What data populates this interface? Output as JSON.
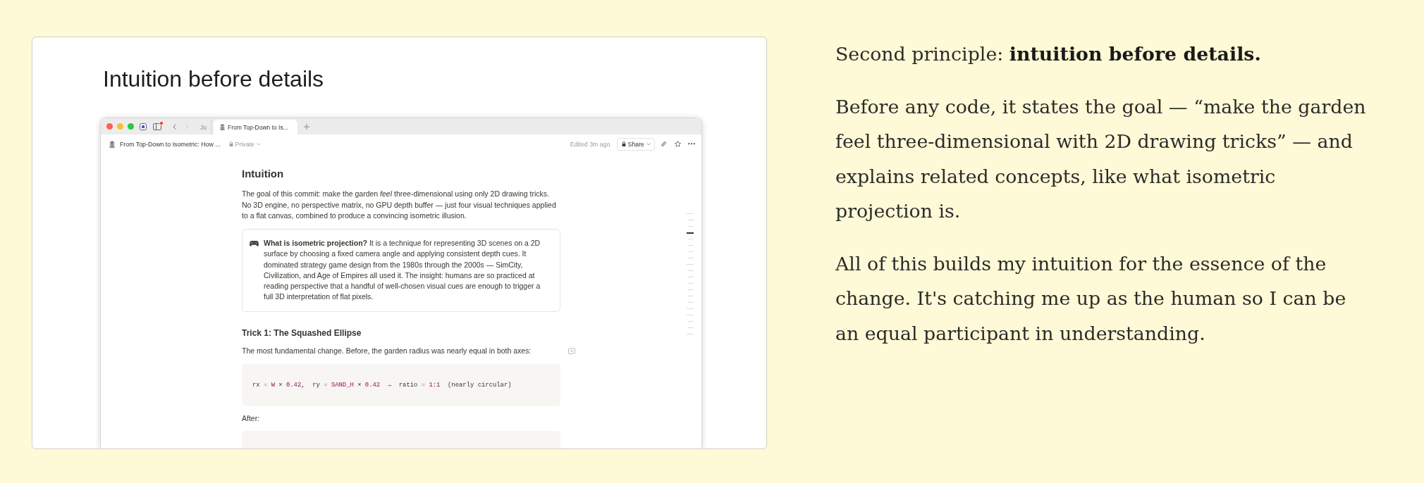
{
  "slide": {
    "title": "Intuition before details"
  },
  "browser": {
    "tabs": [
      {
        "label": "Ju",
        "kind": "compact",
        "selected": false
      },
      {
        "label": "From Top-Down to Is...",
        "kind": "page",
        "selected": true
      }
    ],
    "navigation": {
      "back_disabled": false,
      "forward_disabled": true
    },
    "page_title": "From Top-Down to Isometric: How ...",
    "privacy": "Private",
    "edited": "Edited 3m ago",
    "share": "Share"
  },
  "document": {
    "heading": "Intuition",
    "intro": "The goal of this commit: make the garden *feel* three-dimensional using only 2D drawing tricks. No 3D engine, no perspective matrix, no GPU depth buffer — just four visual techniques applied to a flat canvas, combined to produce a convincing isometric illusion.",
    "callout": "**What is isometric projection?** It is a technique for representing 3D scenes on a 2D surface by choosing a fixed camera angle and applying consistent depth cues. It dominated strategy game design from the 1980s through the 2000s — SimCity, Civilization, and Age of Empires all used it. The insight: humans are so practiced at reading perspective that a handful of well-chosen visual cues are enough to trigger a full 3D interpretation of flat pixels.",
    "section_heading": "Trick 1: The Squashed Ellipse",
    "paragraph": "The most fundamental change. Before, the garden radius was nearly equal in both axes:",
    "code": [
      {
        "text": "rx ",
        "kind": "plain"
      },
      {
        "text": "= ",
        "kind": "op"
      },
      {
        "text": "W",
        "kind": "value"
      },
      {
        "text": " × ",
        "kind": "plain"
      },
      {
        "text": "0.42",
        "kind": "value"
      },
      {
        "text": ",  ry ",
        "kind": "plain"
      },
      {
        "text": "= ",
        "kind": "op"
      },
      {
        "text": "SAND_H",
        "kind": "value"
      },
      {
        "text": " × ",
        "kind": "plain"
      },
      {
        "text": "0.42",
        "kind": "value"
      },
      {
        "text": "  →  ratio ",
        "kind": "plain"
      },
      {
        "text": "= ",
        "kind": "op"
      },
      {
        "text": "1:1",
        "kind": "value"
      },
      {
        "text": "  (nearly circular)",
        "kind": "plain"
      }
    ],
    "after_label": "After:"
  },
  "outline": [
    {
      "kind": "long",
      "selected": false
    },
    {
      "kind": "short",
      "selected": false
    },
    {
      "kind": "short",
      "selected": false
    },
    {
      "kind": "long",
      "selected": true
    },
    {
      "kind": "short",
      "selected": false
    },
    {
      "kind": "short",
      "selected": false
    },
    {
      "kind": "short",
      "selected": false
    },
    {
      "kind": "short",
      "selected": false
    },
    {
      "kind": "long",
      "selected": false
    },
    {
      "kind": "short",
      "selected": false
    },
    {
      "kind": "short",
      "selected": false
    },
    {
      "kind": "short",
      "selected": false
    },
    {
      "kind": "short",
      "selected": false
    },
    {
      "kind": "short",
      "selected": false
    },
    {
      "kind": "short",
      "selected": false
    },
    {
      "kind": "long",
      "selected": false
    },
    {
      "kind": "long",
      "selected": false
    },
    {
      "kind": "short",
      "selected": false
    },
    {
      "kind": "short",
      "selected": false
    },
    {
      "kind": "long",
      "selected": false
    }
  ],
  "notes": [
    "Second principle: **intuition before details.**",
    "Before any code, it states the goal — “make the garden feel three-dimensional with 2D drawing tricks” — and explains related concepts, like what isometric projection is.",
    "All of this builds my intuition for the essence of the change. It's catching me up as the human so I can be an equal participant in understanding."
  ]
}
